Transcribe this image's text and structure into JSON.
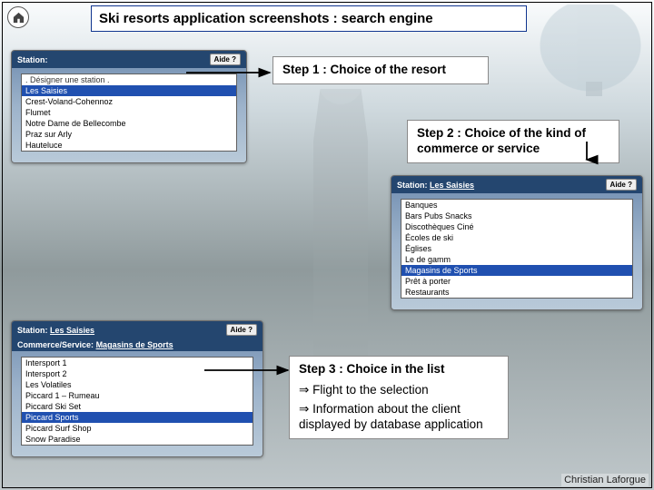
{
  "home_tooltip": "Home",
  "title": "Ski resorts application screenshots :  search engine",
  "credit": "Christian Laforgue",
  "panel1": {
    "station_label": "Station:",
    "aide": "Aide ?",
    "options": [
      ". Désigner une station .",
      "Les Saisies",
      "Crest-Voland-Cohennoz",
      "Flumet",
      "Notre Dame de Bellecombe",
      "Praz sur Arly",
      "Hauteluce"
    ],
    "selected_index": 1
  },
  "panel2": {
    "station_label": "Station:",
    "station_value": "Les Saisies",
    "aide": "Aide ?",
    "options": [
      "Banques",
      "Bars Pubs Snacks",
      "Discothèques Ciné",
      "Écoles de ski",
      "Églises",
      "Le de gamm",
      "Magasins de Sports",
      "Prêt à porter",
      "Restaurants"
    ],
    "selected_index": 6
  },
  "panel3": {
    "station_label": "Station:",
    "station_value": "Les Saisies",
    "commerce_label": "Commerce/Service:",
    "commerce_value": "Magasins de Sports",
    "aide": "Aide ?",
    "options": [
      "Intersport 1",
      "Intersport 2",
      "Les Volatiles",
      "Piccard 1 – Rumeau",
      "Piccard Ski Set",
      "Piccard Sports",
      "Piccard Surf Shop",
      "Snow Paradise"
    ],
    "selected_index": 5
  },
  "step1": "Step 1 : Choice of the resort",
  "step2": "Step 2 : Choice of the kind of commerce or service",
  "step3_line": "Step 3 : Choice in the list",
  "step3_fly": "Flight to the selection",
  "step3_info": "Information about the client displayed by database application",
  "arrow_glyph": "⇒"
}
